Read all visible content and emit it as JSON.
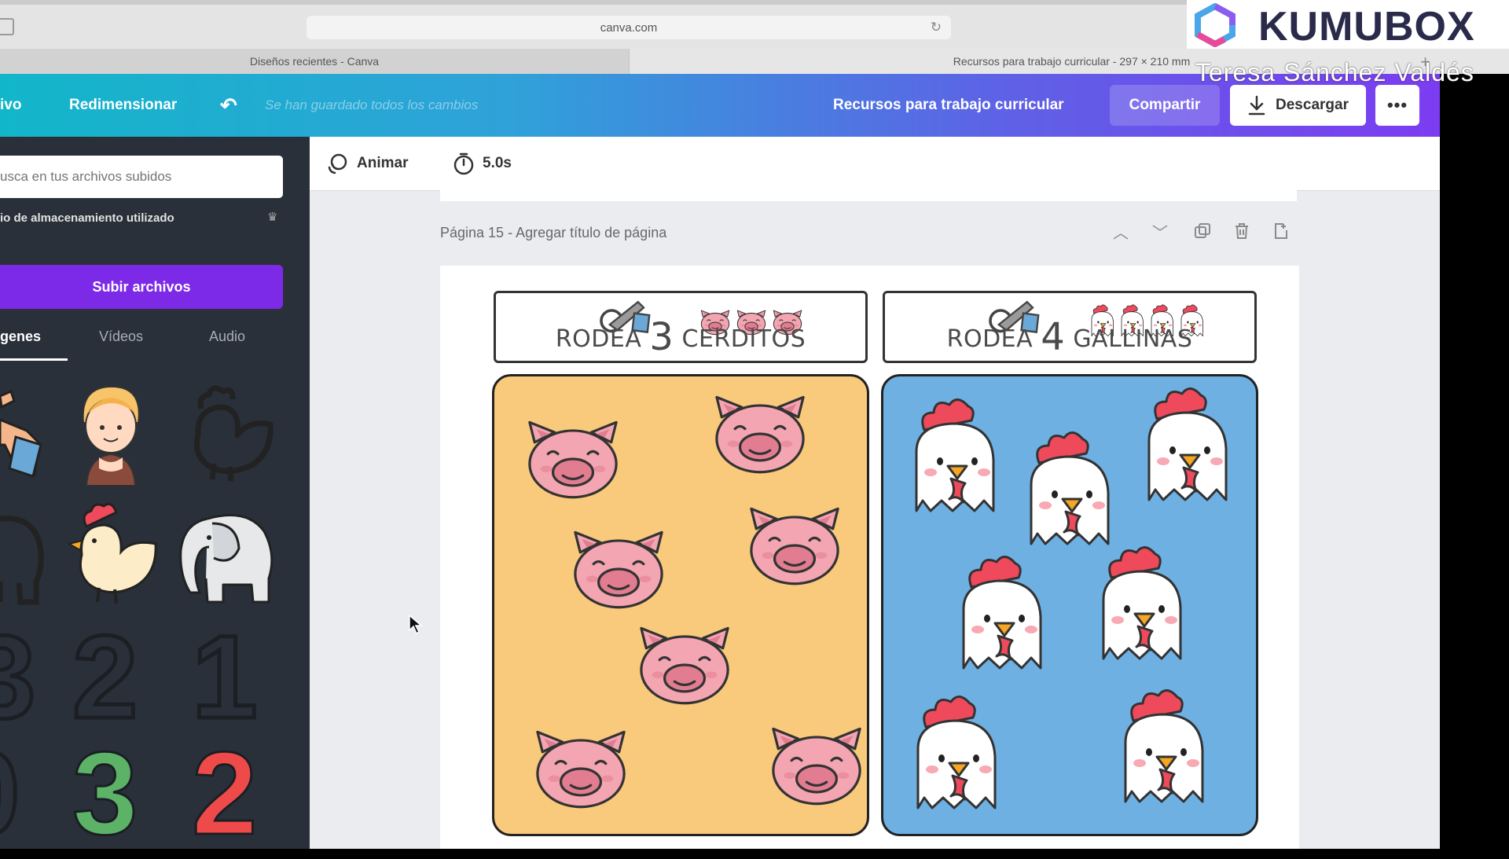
{
  "browser": {
    "url": "canva.com",
    "tabs": [
      {
        "label": "Diseños recientes - Canva"
      },
      {
        "label": "Recursos para trabajo curricular - 297 × 210 mm"
      }
    ]
  },
  "header": {
    "menu_file": "ivo",
    "menu_resize": "Redimensionar",
    "save_status": "Se han guardado todos los cambios",
    "design_title": "Recursos para trabajo curricular",
    "share_label": "Compartir",
    "download_label": "Descargar",
    "more_label": "•••"
  },
  "left_panel": {
    "search_placeholder": "usca en tus archivos subidos",
    "storage_text": "io de almacenamiento utilizado",
    "upload_label": "Subir archivos",
    "tabs": [
      "genes",
      "Vídeos",
      "Audio"
    ],
    "collapse_glyph": "‹"
  },
  "toolbar": {
    "animate_label": "Animar",
    "duration_label": "5.0s"
  },
  "page": {
    "header": "Página 15 - Agregar título de página",
    "box1": {
      "word": "RODEA",
      "number": "3",
      "animal": "CERDITOS"
    },
    "box2": {
      "word": "RODEA",
      "number": "4",
      "animal": "GALLINAS"
    },
    "pig_count": 7,
    "hen_count": 7
  },
  "watermark": {
    "brand": "KUMUBOX",
    "presenter": "Teresa Sánchez Valdés"
  },
  "colors": {
    "header_gradient_start": "#12b6c9",
    "header_gradient_end": "#7c3cf1",
    "upload_button": "#7d2ae8",
    "pig_panel": "#f9c97c",
    "hen_panel": "#6fb0e3",
    "pig_pink": "#f3a5b1"
  },
  "icons": [
    "reload-icon",
    "undo-icon",
    "download-icon",
    "crown-icon",
    "animate-icon",
    "timer-icon",
    "chevron-up-icon",
    "chevron-down-icon",
    "duplicate-icon",
    "trash-icon",
    "add-page-icon",
    "pencil-icon",
    "pig-icon",
    "hen-icon",
    "elephant-icon",
    "girl-icon",
    "cursor-icon"
  ]
}
